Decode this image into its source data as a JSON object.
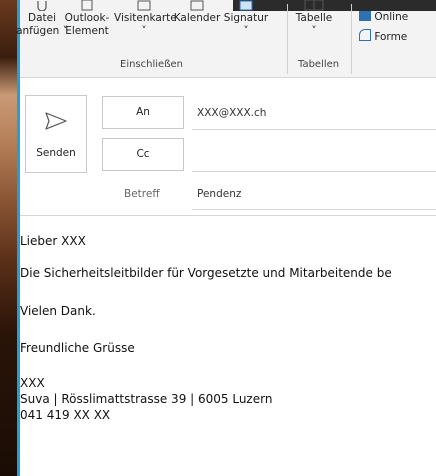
{
  "ribbon": {
    "buttons": [
      {
        "name": "attach-file-button",
        "line1": "Datei",
        "line2": "anfügen ˅"
      },
      {
        "name": "outlook-element-button",
        "line1": "Outlook-",
        "line2": "Element"
      },
      {
        "name": "business-card-button",
        "line1": "Visitenkarte",
        "line2": "˅"
      },
      {
        "name": "calendar-button",
        "line1": "Kalender",
        "line2": ""
      },
      {
        "name": "signature-button",
        "line1": "Signatur",
        "line2": "˅"
      },
      {
        "name": "table-button",
        "line1": "Tabelle",
        "line2": "˅"
      }
    ],
    "side_items": {
      "online": "Online",
      "forms": "Forme"
    },
    "groups": {
      "include": "Einschließen",
      "tables": "Tabellen"
    }
  },
  "header": {
    "send_label": "Senden",
    "to_label": "An",
    "cc_label": "Cc",
    "subject_label": "Betreff",
    "to_value": "XXX@XXX.ch",
    "cc_value": "",
    "subject_value": "Pendenz"
  },
  "message": {
    "greeting": "Lieber XXX",
    "line1": "Die Sicherheitsleitbilder für Vorgesetzte und Mitarbeitende be",
    "thanks": "Vielen Dank.",
    "closing": "Freundliche Grüsse",
    "sig_name": "XXX",
    "sig_address": "Suva | Rösslimattstrasse 39 | 6005 Luzern",
    "sig_phone": "041 419 XX XX"
  }
}
